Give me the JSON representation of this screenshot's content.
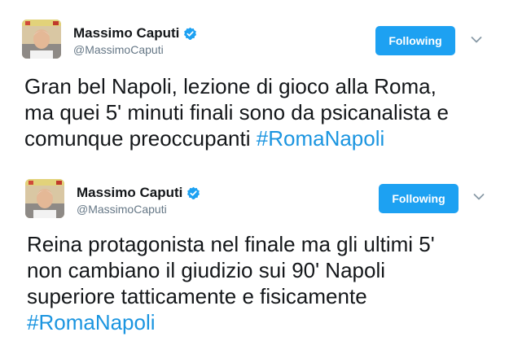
{
  "colors": {
    "follow_button_bg": "#1da1f2",
    "hashtag": "#1b95e0",
    "verified_badge": "#1da1f2",
    "username_gray": "#657786"
  },
  "tweets": [
    {
      "author": {
        "display_name": "Massimo Caputi",
        "username": "@MassimoCaputi",
        "verified": true,
        "avatar_icon": "avatar-photo"
      },
      "follow_label": "Following",
      "menu_icon": "chevron-down-icon",
      "text_lines": [
        "Gran bel Napoli, lezione di gioco alla Roma,",
        "ma quei 5' minuti finali sono da psicanalista e",
        "comunque preoccupanti "
      ],
      "hashtag": "#RomaNapoli"
    },
    {
      "author": {
        "display_name": "Massimo Caputi",
        "username": "@MassimoCaputi",
        "verified": true,
        "avatar_icon": "avatar-photo"
      },
      "follow_label": "Following",
      "menu_icon": "chevron-down-icon",
      "text_lines": [
        "Reina protagonista nel finale ma gli ultimi 5'",
        "non cambiano il giudizio sui 90' Napoli",
        "superiore tatticamente e fisicamente"
      ],
      "hashtag": "#RomaNapoli"
    }
  ]
}
